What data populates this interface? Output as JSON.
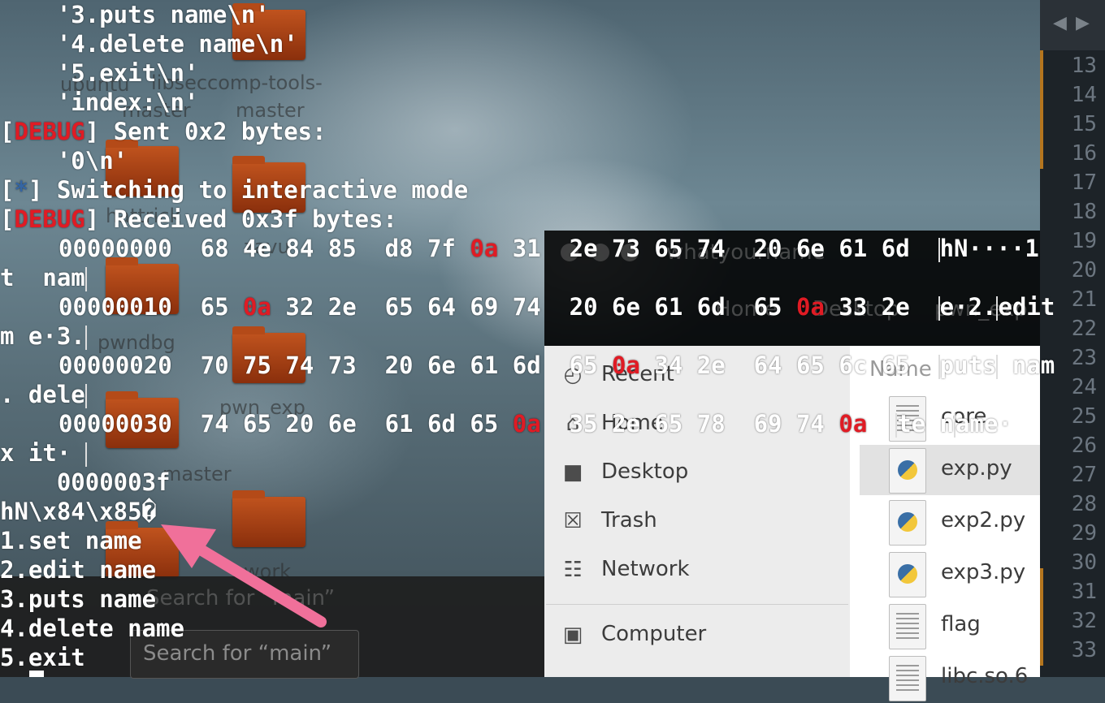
{
  "terminal": {
    "lines": [
      "    '3.puts name\\n'",
      "    '4.delete name\\n'",
      "    '5.exit\\n'",
      "    'index:\\n'",
      "] Sent 0x2 bytes:",
      "    '0\\n'",
      "] Switching to interactive mode",
      "] Received 0x3f bytes:",
      "t  nam",
      "m e·3.",
      ". dele",
      "x it·",
      "    0000003f",
      "hN\\x84\\x85�",
      "1.set name",
      "2.edit name",
      "3.puts name",
      "4.delete name",
      "5.exit"
    ],
    "debug_tag": "DEBUG",
    "star_tag": "*",
    "bracket_open": "[",
    "hex_rows": [
      {
        "offset": "00000000",
        "a": "68 4e 84 85",
        "b": "d8 7f",
        "b_red": "0a",
        "c": " 31",
        "d": "2e 73 65 74",
        "e": "20 6e 61 6d",
        "ascii": "hN····1"
      },
      {
        "offset": "00000010",
        "a": "65",
        "a_red": "0a",
        "a2": "32 2e",
        "b": "65 64 69 74",
        "d": "20 6e 61 6d",
        "e": "65",
        "e_red": "0a",
        "e2": "33 2e",
        "ascii": "e·2.",
        "ascii2": "edit"
      },
      {
        "offset": "00000020",
        "a": "70 75 74 73",
        "b": "20 6e 61 6d",
        "d": "65",
        "d_red": "0a",
        "d2": "34 2e",
        "e": "64 65 6c 65",
        "ascii": "puts",
        "ascii2": "nam"
      },
      {
        "offset": "00000030",
        "a": "74 65 20 6e",
        "b": "61 6d 65",
        "b_red": "0a",
        "d": "35 2e 65 78",
        "e": "69 74",
        "e_red": "0a",
        "ascii": "te n",
        "ascii2": "ame·"
      }
    ]
  },
  "desktop": {
    "labels": [
      "ubuntu",
      "libseccomp-tools-",
      "master",
      "master",
      "hattrick",
      "zavu",
      "pwndbg",
      "pwn_exp",
      "master",
      "work"
    ]
  },
  "search": {
    "placeholder": "Search for “main”",
    "ghost": "Search for “main”"
  },
  "file_manager": {
    "title": "whatyourname",
    "breadcrumbs": [
      "Home",
      "Desktop",
      "pwn_exp"
    ],
    "sidebar": [
      {
        "label": "Recent",
        "icon": "clock-icon",
        "glyph": "◴"
      },
      {
        "label": "Home",
        "icon": "home-icon",
        "glyph": "⌂"
      },
      {
        "label": "Desktop",
        "icon": "folder-icon",
        "glyph": "■"
      },
      {
        "label": "Trash",
        "icon": "trash-icon",
        "glyph": "☒"
      },
      {
        "label": "Network",
        "icon": "network-icon",
        "glyph": "☷"
      },
      {
        "label": "Computer",
        "icon": "computer-icon",
        "glyph": "▣"
      }
    ],
    "column_header": "Name",
    "files": [
      {
        "name": "core",
        "type": "text"
      },
      {
        "name": "exp.py",
        "type": "python",
        "selected": true
      },
      {
        "name": "exp2.py",
        "type": "python"
      },
      {
        "name": "exp3.py",
        "type": "python"
      },
      {
        "name": "flag",
        "type": "text"
      },
      {
        "name": "libc.so.6",
        "type": "text"
      }
    ]
  },
  "editor": {
    "line_numbers": [
      "13",
      "14",
      "15",
      "16",
      "17",
      "18",
      "19",
      "20",
      "21",
      "22",
      "23",
      "24",
      "25",
      "26",
      "27",
      "28",
      "29",
      "30",
      "31",
      "32",
      "33"
    ],
    "nav_back": "◀",
    "nav_forward": "▶"
  },
  "colors": {
    "terminal_text": "#ffffff",
    "debug_red": "#e01b24",
    "star_blue": "#3465a4",
    "arrow_pink": "#f0709a"
  }
}
